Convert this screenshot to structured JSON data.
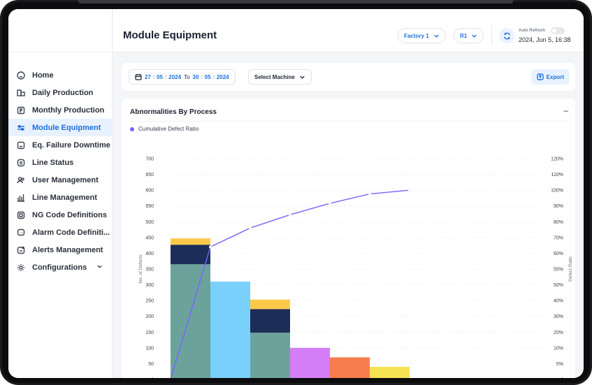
{
  "header": {
    "title": "Module Equipment",
    "factory_select": "Factory 1",
    "line_select": "R1",
    "auto_refresh_label": "Auto Refresh",
    "auto_refresh_on": false,
    "datetime": "2024, Jun 5, 16:38"
  },
  "sidebar": {
    "items": [
      {
        "label": "Home",
        "icon": "home-icon"
      },
      {
        "label": "Daily Production",
        "icon": "daily-production-icon"
      },
      {
        "label": "Monthly Production",
        "icon": "monthly-production-icon"
      },
      {
        "label": "Module Equipment",
        "icon": "module-equipment-icon",
        "active": true
      },
      {
        "label": "Eq. Failure Downtime",
        "icon": "failure-downtime-icon"
      },
      {
        "label": "Line Status",
        "icon": "line-status-icon"
      },
      {
        "label": "User Management",
        "icon": "users-icon"
      },
      {
        "label": "Line Management",
        "icon": "line-management-icon"
      },
      {
        "label": "NG Code Definitions",
        "icon": "ng-code-icon"
      },
      {
        "label": "Alarm Code Definiti...",
        "icon": "alarm-code-icon"
      },
      {
        "label": "Alerts Management",
        "icon": "alerts-icon"
      },
      {
        "label": "Configurations",
        "icon": "configurations-icon"
      }
    ]
  },
  "filters": {
    "date_from": {
      "day": "27",
      "month": "05",
      "year": "2024"
    },
    "to_label": "To",
    "date_to": {
      "day": "30",
      "month": "05",
      "year": "2024"
    },
    "sep": "/",
    "machine_select": "Select Machine",
    "export_label": "Export"
  },
  "chart_card": {
    "title": "Abnormalities By Process",
    "collapse_symbol": "–"
  },
  "colors": {
    "accent": "#1e6fd9",
    "line": "#7b61ff",
    "teal": "#6ba39c",
    "navy": "#1c2d57",
    "yellow": "#fcc84a",
    "sky": "#79d0fb",
    "violet": "#d57cf7",
    "orange": "#f57d4e",
    "lemon": "#f5e353"
  },
  "chart_data": {
    "type": "bar",
    "stacked": true,
    "ylabel": "No. of Defects",
    "y2label": "Defect Ratio",
    "ylim": [
      0,
      700
    ],
    "yticks": [
      0,
      50,
      100,
      150,
      200,
      250,
      300,
      350,
      400,
      450,
      500,
      550,
      600,
      650,
      700
    ],
    "y2ticks": [
      "0",
      "5%",
      "10%",
      "20%",
      "30%",
      "40%",
      "50%",
      "55%",
      "60%",
      "70%",
      "80%",
      "90%",
      "100%",
      "110%",
      "120%"
    ],
    "bars": [
      {
        "segments": [
          {
            "value": 365,
            "color": "#6ba39c"
          },
          {
            "value": 62,
            "color": "#1c2d57"
          },
          {
            "value": 20,
            "color": "#fcc84a"
          }
        ]
      },
      {
        "segments": [
          {
            "value": 310,
            "color": "#79d0fb"
          }
        ]
      },
      {
        "segments": [
          {
            "value": 148,
            "color": "#6ba39c"
          },
          {
            "value": 75,
            "color": "#1c2d57"
          },
          {
            "value": 30,
            "color": "#fcc84a"
          }
        ]
      },
      {
        "segments": [
          {
            "value": 100,
            "color": "#d57cf7"
          }
        ]
      },
      {
        "segments": [
          {
            "value": 70,
            "color": "#f57d4e"
          }
        ]
      },
      {
        "segments": [
          {
            "value": 40,
            "color": "#f5e353"
          }
        ]
      }
    ],
    "series": [
      {
        "name": "Cumulative Defect Ratio",
        "type": "line",
        "values": [
          0,
          70,
          80,
          87,
          93,
          98,
          100
        ]
      }
    ]
  }
}
